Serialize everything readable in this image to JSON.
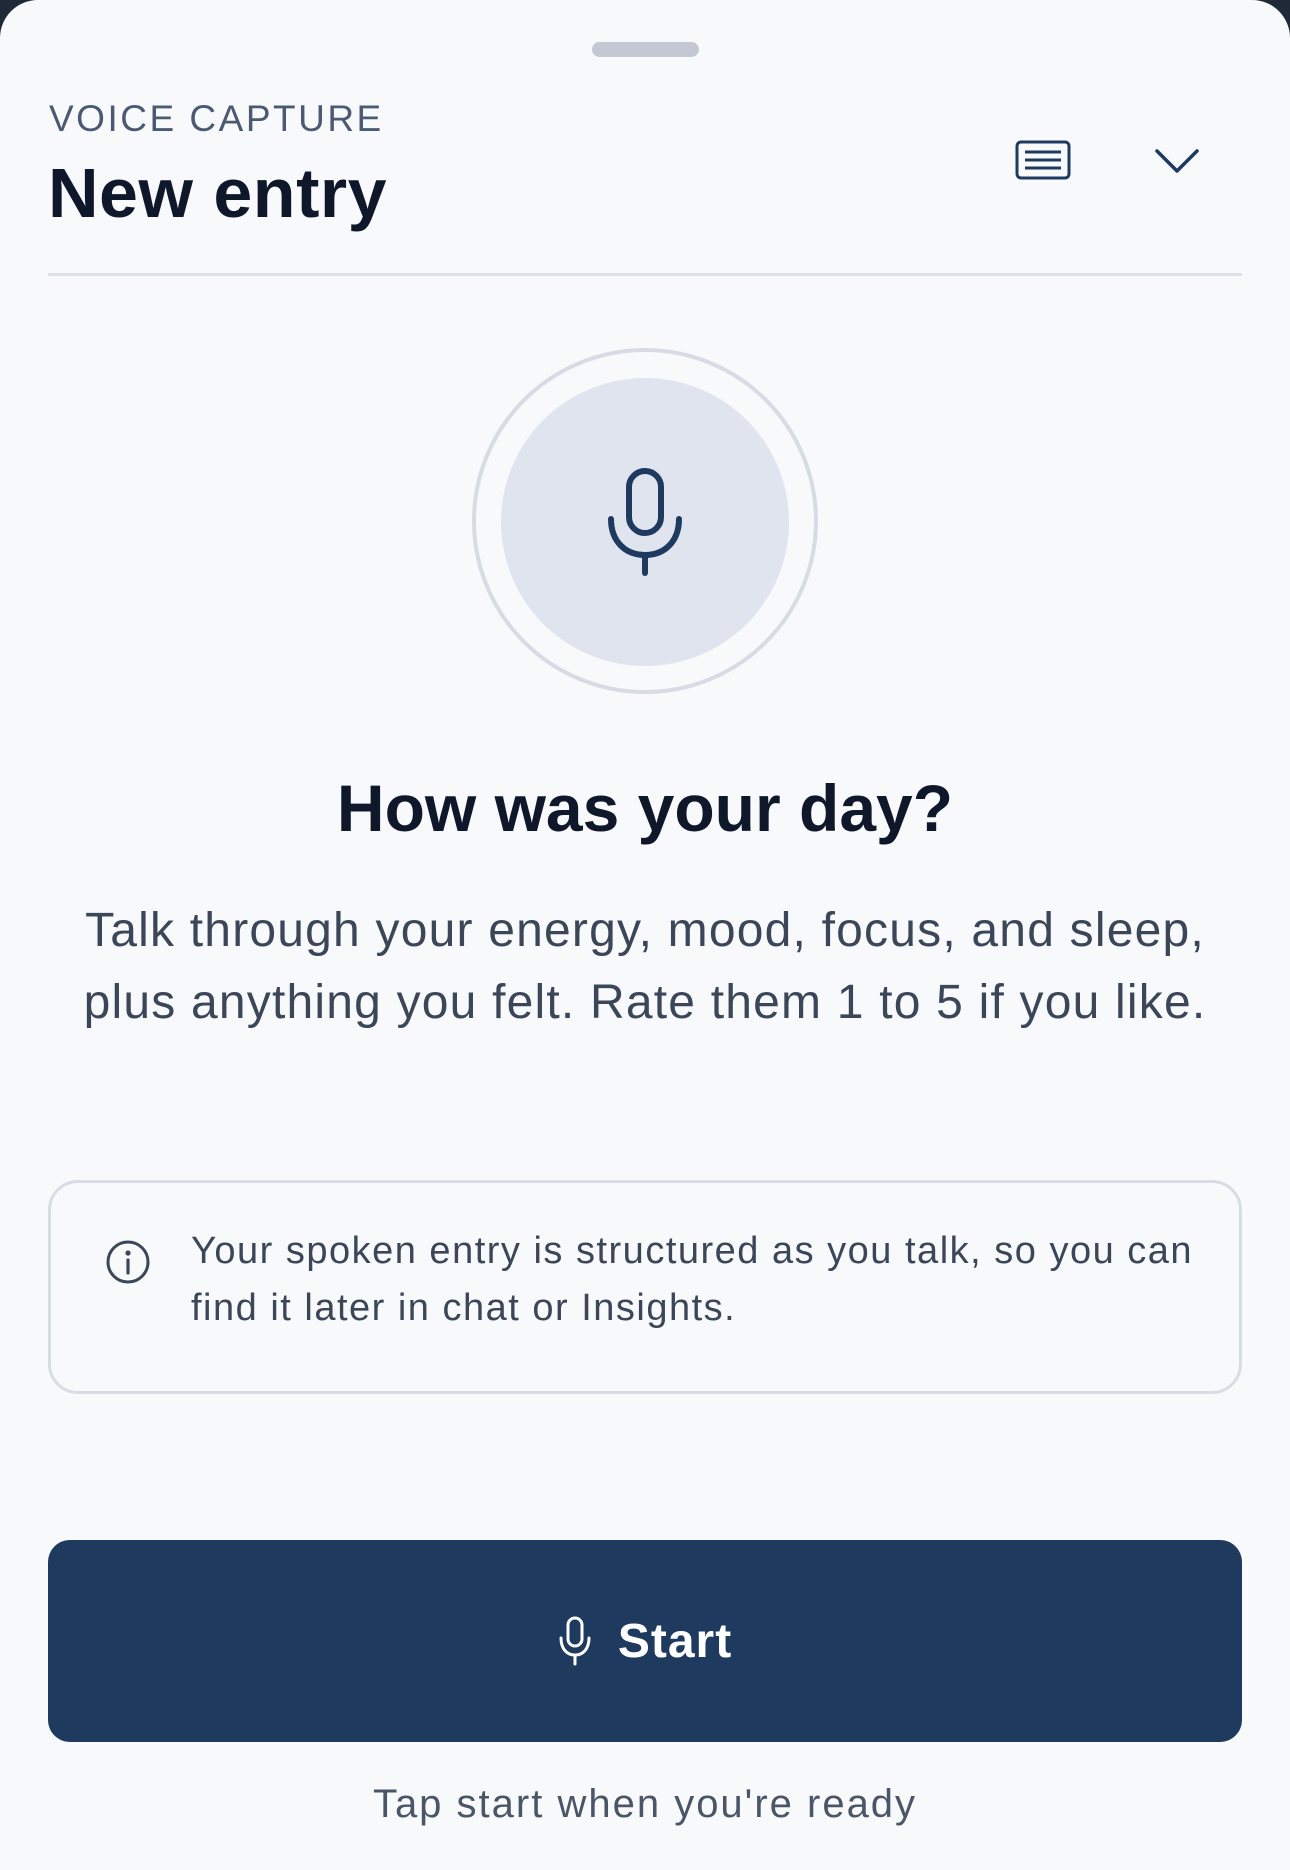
{
  "sheet": {
    "eyebrow": "VOICE CAPTURE",
    "title": "New entry",
    "keyboard_icon": "keyboard-icon",
    "collapse_icon": "chevron-down-icon"
  },
  "prompt": {
    "mic_icon": "microphone-icon",
    "question": "How was your day?",
    "description": "Talk through your energy, mood, focus, and sleep, plus anything you felt. Rate them 1 to 5 if you like."
  },
  "info": {
    "icon": "info-icon",
    "text": "Your spoken entry is structured as you talk, so you can find it later in chat or Insights."
  },
  "action": {
    "start_label": "Start",
    "start_icon": "microphone-icon",
    "hint": "Tap start when you're ready"
  },
  "colors": {
    "primary": "#1f3a5f",
    "background": "#f8f9fb",
    "mic_circle": "#dfe4ee",
    "text_primary": "#0f172a",
    "text_secondary": "#3b4658"
  }
}
